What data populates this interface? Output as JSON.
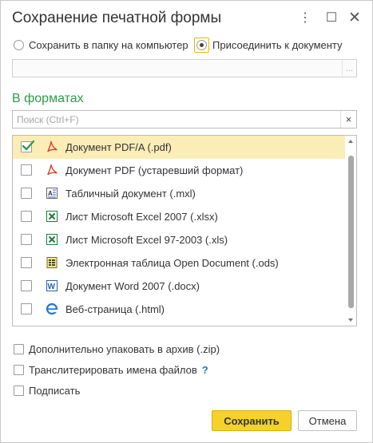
{
  "window": {
    "title": "Сохранение печатной формы",
    "more_glyph": "⋮",
    "maximize_glyph": "☐",
    "close_glyph": "✕"
  },
  "destination": {
    "option_folder": "Сохранить в папку на компьютер",
    "option_attach": "Присоединить к документу",
    "selected": "attach",
    "path_value": "",
    "path_button": "..."
  },
  "formats": {
    "heading": "В форматах",
    "search_placeholder": "Поиск (Ctrl+F)",
    "search_clear": "×",
    "items": [
      {
        "label": "Документ PDF/A (.pdf)",
        "checked": true,
        "selected": true,
        "icon": "pdf-icon"
      },
      {
        "label": "Документ PDF (устаревший формат)",
        "checked": false,
        "selected": false,
        "icon": "pdf-icon"
      },
      {
        "label": "Табличный документ (.mxl)",
        "checked": false,
        "selected": false,
        "icon": "mxl-icon"
      },
      {
        "label": "Лист Microsoft Excel 2007 (.xlsx)",
        "checked": false,
        "selected": false,
        "icon": "excel-icon"
      },
      {
        "label": "Лист Microsoft Excel 97-2003 (.xls)",
        "checked": false,
        "selected": false,
        "icon": "excel-icon"
      },
      {
        "label": "Электронная таблица Open Document (.ods)",
        "checked": false,
        "selected": false,
        "icon": "ods-icon"
      },
      {
        "label": "Документ Word 2007 (.docx)",
        "checked": false,
        "selected": false,
        "icon": "word-icon"
      },
      {
        "label": "Веб-страница (.html)",
        "checked": false,
        "selected": false,
        "icon": "web-icon"
      }
    ]
  },
  "options": {
    "zip": {
      "label": "Дополнительно упаковать в архив (.zip)",
      "checked": false
    },
    "transliterate": {
      "label": "Транслитерировать имена файлов",
      "checked": false,
      "help": "?"
    },
    "sign": {
      "label": "Подписать",
      "checked": false
    }
  },
  "buttons": {
    "save": "Сохранить",
    "cancel": "Отмена"
  },
  "colors": {
    "accent_green": "#2e9e45",
    "selection": "#fbedb6",
    "primary_button": "#f6d12a",
    "check_green": "#2e9e45"
  }
}
